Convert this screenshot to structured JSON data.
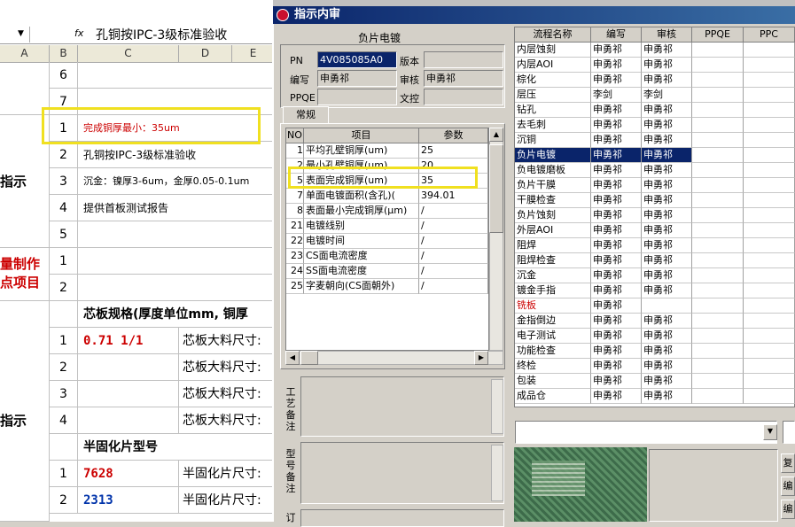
{
  "formula_bar": {
    "fx": "fx",
    "text": "孔铜按IPC-3级标准验收"
  },
  "sheet": {
    "col_headers": [
      "A",
      "B",
      "C",
      "D",
      "E"
    ],
    "rows": [
      {
        "num": "6",
        "c": ""
      },
      {
        "num": "7",
        "c": ""
      },
      {
        "num": "1",
        "c": "完成铜厚最小：35um"
      },
      {
        "num": "2",
        "c": "孔铜按IPC-3级标准验收"
      },
      {
        "num": "3",
        "c": "沉金：镍厚3-6um，金厚0.05-0.1um"
      },
      {
        "num": "4",
        "c": "提供首板测试报告"
      },
      {
        "num": "5",
        "c": ""
      },
      {
        "num": "1",
        "c": ""
      },
      {
        "num": "2",
        "c": ""
      },
      {
        "num": "",
        "c": "芯板规格(厚度单位mm, 铜厚"
      },
      {
        "num": "1",
        "c": "0.71 1/1",
        "d": "芯板大料尺寸:"
      },
      {
        "num": "2",
        "c": "",
        "d": "芯板大料尺寸:"
      },
      {
        "num": "3",
        "c": "",
        "d": "芯板大料尺寸:"
      },
      {
        "num": "4",
        "c": "",
        "d": "芯板大料尺寸:"
      },
      {
        "num": "",
        "c": "半固化片型号"
      },
      {
        "num": "1",
        "c": "7628",
        "d": "半固化片尺寸:"
      },
      {
        "num": "2",
        "c": "2313",
        "d": "半固化片尺寸:"
      }
    ],
    "left_labels": {
      "zhishi1": "指示",
      "qc_line1": "量制作",
      "qc_line2": "点项目",
      "zhishi2": "指示"
    }
  },
  "dialog": {
    "title": "指示内审",
    "group_title": "负片电镀",
    "pn_label": "PN",
    "pn_value": "4V085085A0",
    "version_label": "版本",
    "version_value": "",
    "author_label": "编写",
    "author_value": "申勇祁",
    "reviewer_label": "审核",
    "reviewer_value": "申勇祁",
    "ppqe_label": "PPQE",
    "ppqe_value": "",
    "doc_label": "文控",
    "doc_value": "",
    "tab_label": "常规",
    "param_headers": [
      "NO",
      "项目",
      "参数"
    ],
    "params": [
      {
        "no": "1",
        "item": "平均孔壁铜厚(um)",
        "val": "25"
      },
      {
        "no": "2",
        "item": "最小孔壁铜厚(um)",
        "val": "20"
      },
      {
        "no": "5",
        "item": "表面完成铜厚(um)",
        "val": "35"
      },
      {
        "no": "7",
        "item": "单面电镀面积(含孔)(",
        "val": "394.01"
      },
      {
        "no": "8",
        "item": "表面最小完成铜厚(μm)",
        "val": "/"
      },
      {
        "no": "21",
        "item": "电镀线别",
        "val": "/"
      },
      {
        "no": "22",
        "item": "电镀时间",
        "val": "/"
      },
      {
        "no": "23",
        "item": "CS面电流密度",
        "val": "/"
      },
      {
        "no": "24",
        "item": "SS面电流密度",
        "val": "/"
      },
      {
        "no": "25",
        "item": "字麦朝向(CS面朝外)",
        "val": "/"
      }
    ],
    "memo_labels": {
      "craft": "工艺备注",
      "model": "型号备注",
      "more": "订"
    },
    "process_headers": [
      "流程名称",
      "编写",
      "审核",
      "PPQE",
      "PPC"
    ],
    "processes": [
      {
        "name": "内层蚀刻",
        "author": "申勇祁",
        "reviewer": "申勇祁"
      },
      {
        "name": "内层AOI",
        "author": "申勇祁",
        "reviewer": "申勇祁"
      },
      {
        "name": "棕化",
        "author": "申勇祁",
        "reviewer": "申勇祁"
      },
      {
        "name": "层压",
        "author": "李剑",
        "reviewer": "李剑"
      },
      {
        "name": "钻孔",
        "author": "申勇祁",
        "reviewer": "申勇祁"
      },
      {
        "name": "去毛刺",
        "author": "申勇祁",
        "reviewer": "申勇祁"
      },
      {
        "name": "沉铜",
        "author": "申勇祁",
        "reviewer": "申勇祁"
      },
      {
        "name": "负片电镀",
        "author": "申勇祁",
        "reviewer": "申勇祁"
      },
      {
        "name": "负电镀磨板",
        "author": "申勇祁",
        "reviewer": "申勇祁"
      },
      {
        "name": "负片干膜",
        "author": "申勇祁",
        "reviewer": "申勇祁"
      },
      {
        "name": "干膜检查",
        "author": "申勇祁",
        "reviewer": "申勇祁"
      },
      {
        "name": "负片蚀刻",
        "author": "申勇祁",
        "reviewer": "申勇祁"
      },
      {
        "name": "外层AOI",
        "author": "申勇祁",
        "reviewer": "申勇祁"
      },
      {
        "name": "阻焊",
        "author": "申勇祁",
        "reviewer": "申勇祁"
      },
      {
        "name": "阻焊检查",
        "author": "申勇祁",
        "reviewer": "申勇祁"
      },
      {
        "name": "沉金",
        "author": "申勇祁",
        "reviewer": "申勇祁"
      },
      {
        "name": "镀金手指",
        "author": "申勇祁",
        "reviewer": "申勇祁"
      },
      {
        "name": "铣板",
        "author": "申勇祁",
        "reviewer": ""
      },
      {
        "name": "金指倒边",
        "author": "申勇祁",
        "reviewer": "申勇祁"
      },
      {
        "name": "电子测试",
        "author": "申勇祁",
        "reviewer": "申勇祁"
      },
      {
        "name": "功能检查",
        "author": "申勇祁",
        "reviewer": "申勇祁"
      },
      {
        "name": "终检",
        "author": "申勇祁",
        "reviewer": "申勇祁"
      },
      {
        "name": "包装",
        "author": "申勇祁",
        "reviewer": "申勇祁"
      },
      {
        "name": "成品仓",
        "author": "申勇祁",
        "reviewer": "申勇祁"
      }
    ],
    "side_buttons": [
      "复",
      "编",
      "编"
    ]
  }
}
